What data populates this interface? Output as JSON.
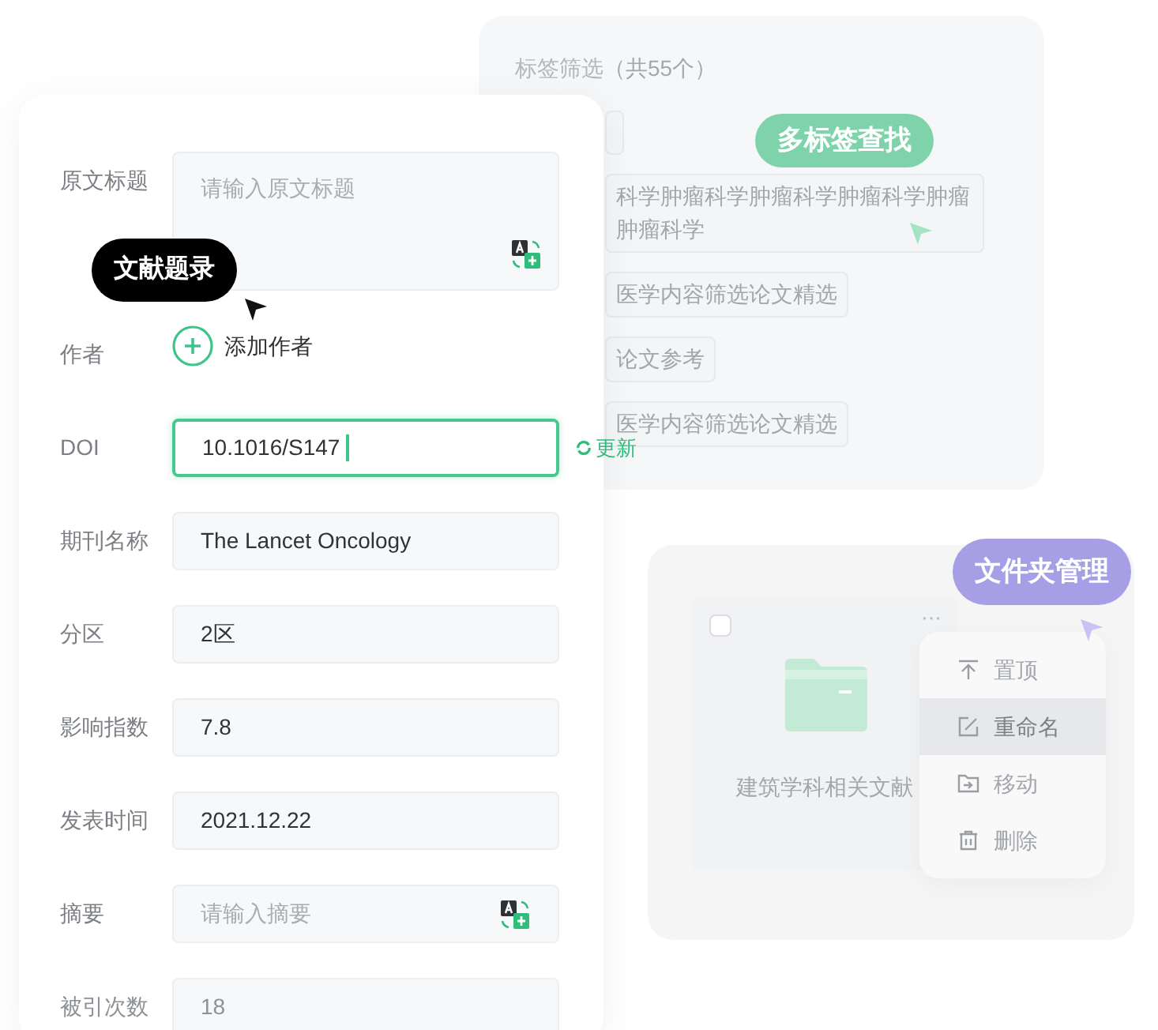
{
  "tag_panel": {
    "title": "标签筛选",
    "count": "（共55个）",
    "badge": "多标签查找",
    "tags": [
      {
        "label": "科学肿瘤科学肿瘤科学肿瘤科学肿瘤肿瘤科学"
      },
      {
        "label": "医学内容筛选论文精选"
      },
      {
        "label": "论文参考"
      },
      {
        "label": "医学内容筛选论文精选"
      }
    ]
  },
  "folder_panel": {
    "badge": "文件夹管理",
    "folder": {
      "name": "建筑学科相关文献",
      "checked": false,
      "more": "···"
    },
    "menu": [
      {
        "label": "置顶",
        "selected": false
      },
      {
        "label": "重命名",
        "selected": true
      },
      {
        "label": "移动",
        "selected": false
      },
      {
        "label": "删除",
        "selected": false
      }
    ]
  },
  "form": {
    "tooltip": "文献题录",
    "fields": [
      {
        "label": "原文标题",
        "kind": "textarea",
        "placeholder": "请输入原文标题",
        "translate": true,
        "focused": false,
        "faded": false
      },
      {
        "label": "作者",
        "kind": "add",
        "action": "添加作者",
        "faded": false
      },
      {
        "label": "DOI",
        "kind": "input",
        "value": "10.1016/S147",
        "focused": true,
        "translate": false,
        "action": "更新",
        "faded": false
      },
      {
        "label": "期刊名称",
        "kind": "input",
        "value": "The Lancet Oncology",
        "focused": false,
        "translate": false,
        "faded": false
      },
      {
        "label": "分区",
        "kind": "input",
        "value": "2区",
        "focused": false,
        "translate": false,
        "faded": false
      },
      {
        "label": "影响指数",
        "kind": "input",
        "value": "7.8",
        "focused": false,
        "translate": false,
        "faded": false
      },
      {
        "label": "发表时间",
        "kind": "input",
        "value": "2021.12.22",
        "focused": false,
        "translate": false,
        "faded": false
      },
      {
        "label": "摘要",
        "kind": "input",
        "placeholder": "请输入摘要",
        "focused": false,
        "translate": true,
        "faded": false
      },
      {
        "label": "被引次数",
        "kind": "input",
        "value": "18",
        "focused": false,
        "translate": false,
        "faded": true
      }
    ]
  }
}
